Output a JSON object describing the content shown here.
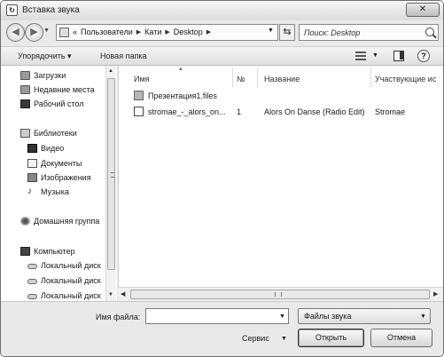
{
  "window": {
    "title": "Вставка звука",
    "close_label": "✕"
  },
  "navbar": {
    "breadcrumbs": [
      "«",
      "Пользователи",
      "Кати",
      "Desktop"
    ],
    "search_placeholder": "Поиск: Desktop"
  },
  "toolbar": {
    "organize_label": "Упорядочить ▾",
    "new_folder_label": "Новая папка",
    "help_label": "?"
  },
  "navigation": {
    "items": [
      {
        "label": "Загрузки",
        "icon": "downloads-folder-icon"
      },
      {
        "label": "Недавние места",
        "icon": "recent-places-icon"
      },
      {
        "label": "Рабочий стол",
        "icon": "desktop-icon"
      },
      {
        "label": "Библиотеки",
        "icon": "libraries-icon"
      },
      {
        "label": "Видео",
        "icon": "video-icon"
      },
      {
        "label": "Документы",
        "icon": "documents-icon"
      },
      {
        "label": "Изображения",
        "icon": "images-icon"
      },
      {
        "label": "Музыка",
        "icon": "music-icon"
      },
      {
        "label": "Домашняя группа",
        "icon": "homegroup-icon"
      },
      {
        "label": "Компьютер",
        "icon": "computer-icon"
      },
      {
        "label": "Локальный диск",
        "icon": "disk-icon"
      },
      {
        "label": "Локальный диск",
        "icon": "disk-icon"
      },
      {
        "label": "Локальный диск",
        "icon": "disk-icon"
      }
    ]
  },
  "files": {
    "columns": [
      "Имя",
      "№",
      "Название",
      "Участвующие ис"
    ],
    "rows": [
      {
        "name": "Презентация1.files",
        "number": "",
        "title": "",
        "artist": "",
        "icon": "folder-icon"
      },
      {
        "name": "stromae_-_alors_on...",
        "number": "1",
        "title": "Alors On Danse (Radio Edit)",
        "artist": "Stromae",
        "icon": "audio-file-icon"
      }
    ]
  },
  "bottom": {
    "filename_label": "Имя файла:",
    "filename_value": "",
    "filetype_value": "Файлы звука",
    "service_label": "Сервис",
    "open_label": "Открыть",
    "cancel_label": "Отмена"
  }
}
